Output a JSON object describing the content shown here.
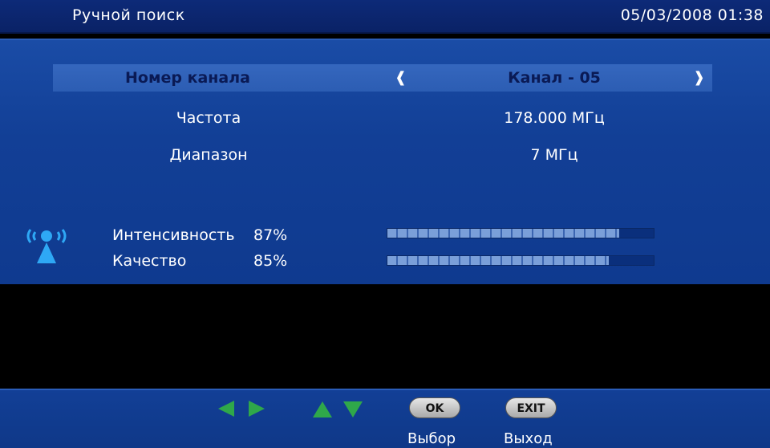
{
  "header": {
    "title": "Ручной поиск",
    "datetime": "05/03/2008 01:38"
  },
  "settings": {
    "channel": {
      "label": "Номер канала",
      "value": "Канал - 05"
    },
    "frequency": {
      "label": "Частота",
      "value": "178.000 МГц"
    },
    "bandwidth": {
      "label": "Диапазон",
      "value": "7 МГц"
    }
  },
  "signal": {
    "intensity": {
      "label": "Интенсивность",
      "percent_text": "87%",
      "level": 0.87
    },
    "quality": {
      "label": "Качество",
      "percent_text": "85%",
      "level": 0.83
    }
  },
  "footer": {
    "ok_label": "OK",
    "exit_label": "EXIT",
    "select_label": "Выбор",
    "exit_text": "Выход"
  },
  "colors": {
    "nav_arrows": "#2fa84a",
    "selected_row": "#2c5db3",
    "main_bg": "#123f96",
    "signal_icon": "#2ea8f5"
  },
  "icons": {
    "left_right": "left-right-arrows-icon",
    "up_down": "up-down-arrows-icon",
    "signal": "antenna-signal-icon"
  }
}
